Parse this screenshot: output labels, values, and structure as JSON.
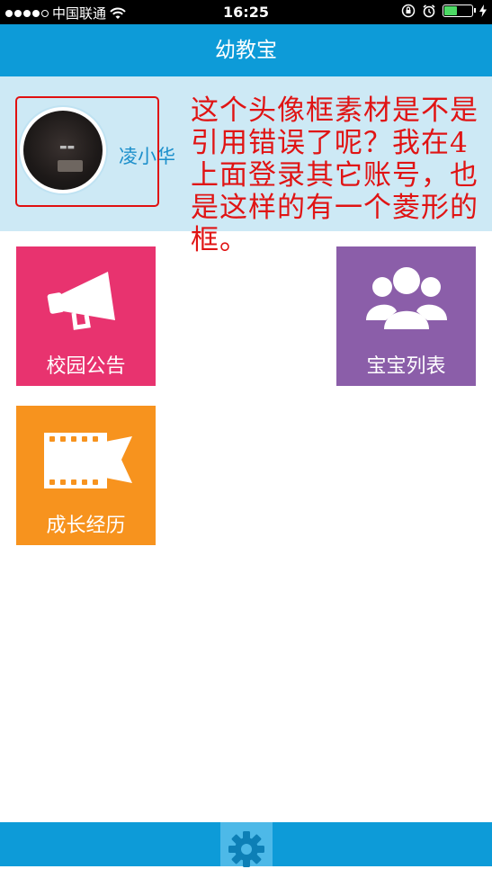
{
  "status_bar": {
    "carrier": "中国联通",
    "time": "16:25"
  },
  "nav": {
    "title": "幼教宝"
  },
  "profile": {
    "username": "凌小华",
    "annotation": "这个头像框素材是不是引用错误了呢？我在4上面登录其它账号，也是这样的有一个菱形的框。"
  },
  "tiles": [
    {
      "label": "校园公告",
      "color": "#e8336f",
      "icon": "megaphone-icon"
    },
    {
      "label": "宝宝列表",
      "color": "#8b5ea9",
      "icon": "people-icon"
    },
    {
      "label": "成长经历",
      "color": "#f7931e",
      "icon": "film-icon"
    }
  ],
  "colors": {
    "primary": "#0d9bd8",
    "annotation_red": "#e01414"
  },
  "bottom_bar": {
    "icon": "gear-icon"
  }
}
